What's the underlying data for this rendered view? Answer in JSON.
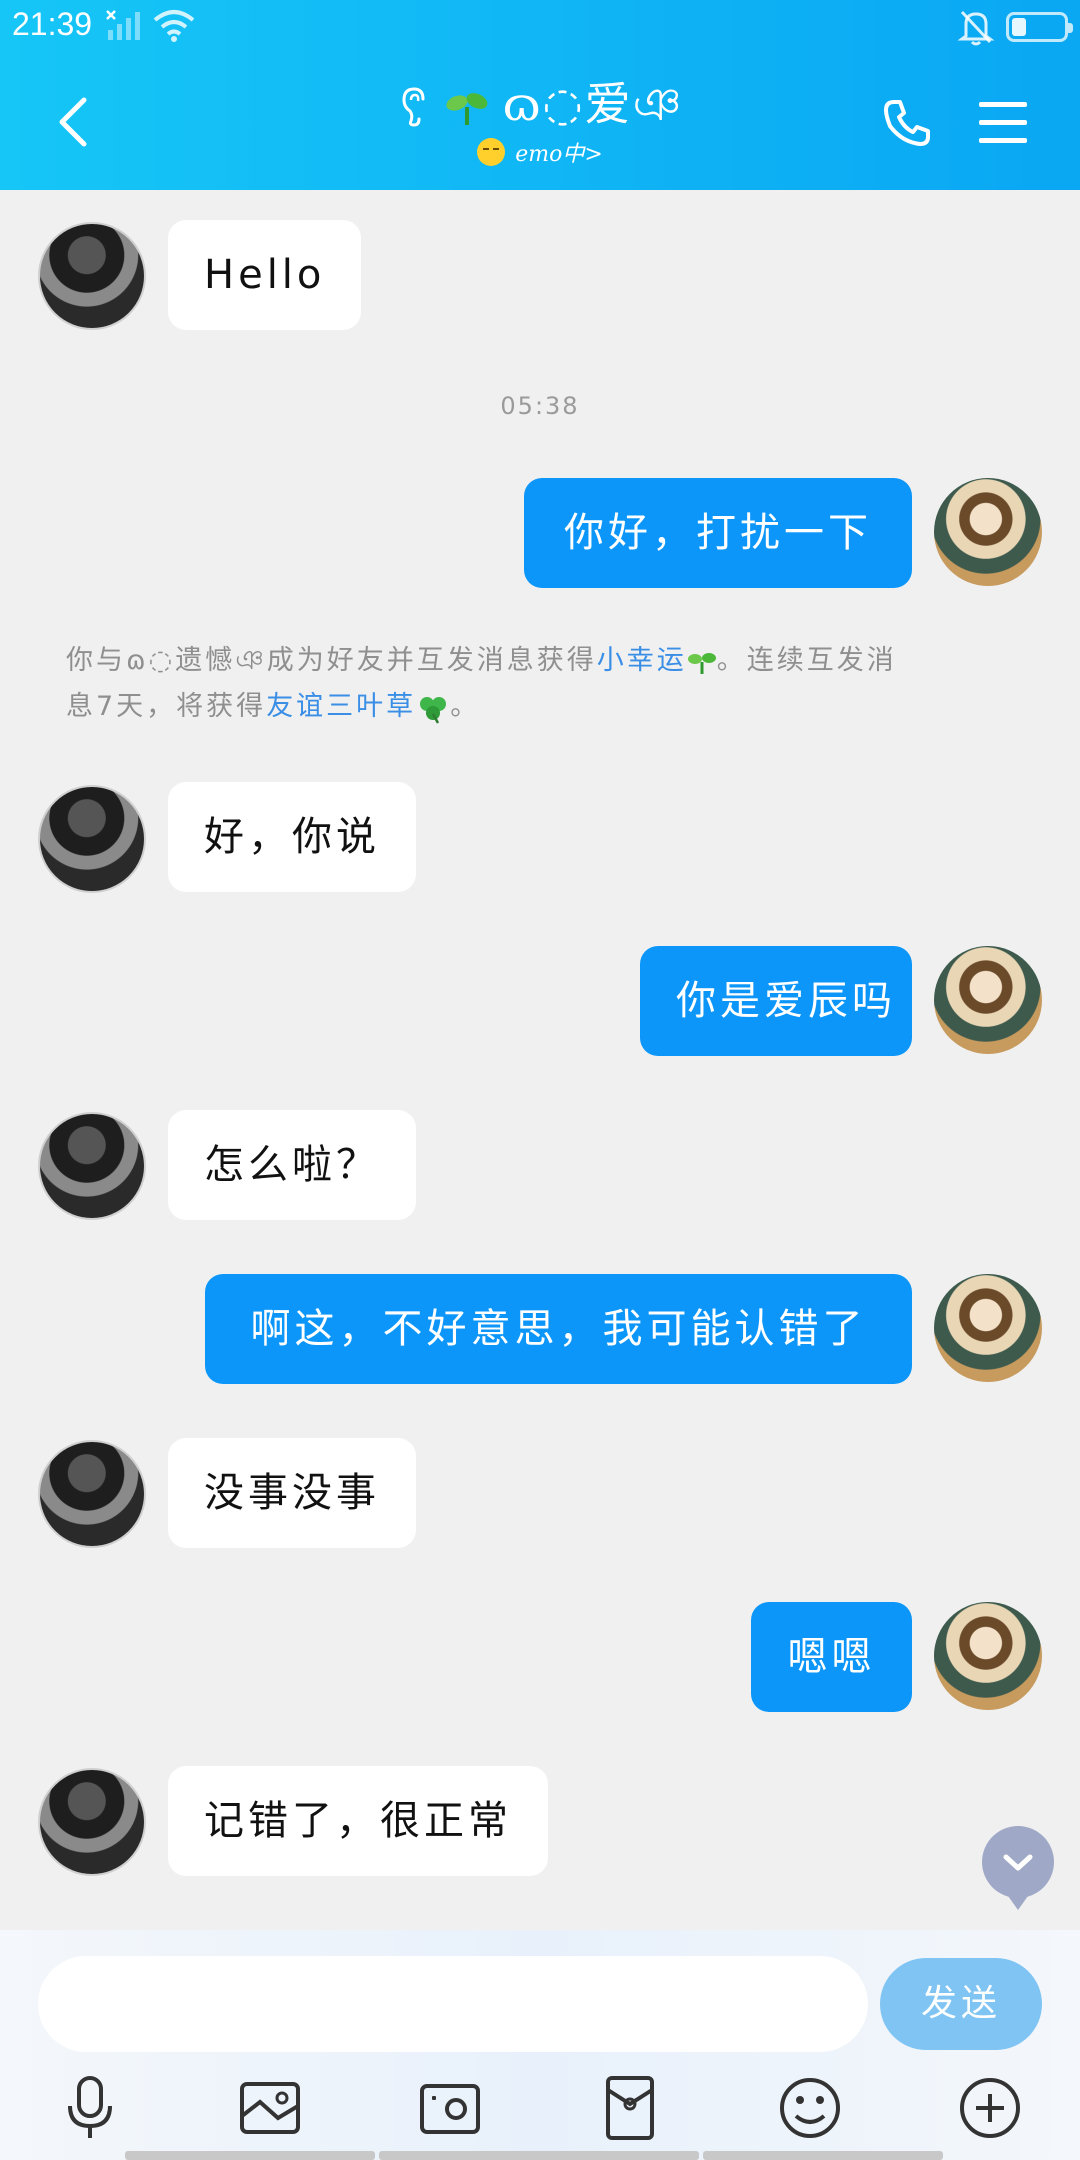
{
  "status_bar": {
    "time": "21:39"
  },
  "header": {
    "title": "ɷ◌爱ঞ",
    "user_status": "emo中>"
  },
  "messages": {
    "m1": "Hello",
    "time1": "05:38",
    "m2": "你好，打扰一下",
    "system_note": {
      "line1_a": "你与",
      "friend_name": "ɷ◌遗憾ঞ",
      "line1_b": "成为好友并互发消息获得",
      "link1": "小幸运",
      "line1_c": "。连续互发消",
      "line2_a": "息7天，将获得",
      "link2": "友谊三叶草",
      "line2_b": "。"
    },
    "m3": "好，你说",
    "m4": "你是爱辰吗",
    "m5": "怎么啦？",
    "m6": "啊这，不好意思，我可能认错了",
    "m7": "没事没事",
    "m8": "嗯嗯",
    "m9": "记错了，很正常"
  },
  "composer": {
    "placeholder": "",
    "send_label": "发送"
  },
  "icons": {
    "back": "back-arrow-icon",
    "call": "phone-icon",
    "menu": "menu-icon",
    "voice": "microphone-icon",
    "photo": "image-icon",
    "camera": "camera-icon",
    "red_packet": "red-packet-icon",
    "emoji": "emoji-icon",
    "more": "plus-icon"
  },
  "colors": {
    "header_bg": "#10b6f5",
    "outgoing_bubble": "#0c96fa",
    "incoming_bubble": "#ffffff",
    "link": "#3a8ee6",
    "send_button": "#7fc4f3"
  }
}
